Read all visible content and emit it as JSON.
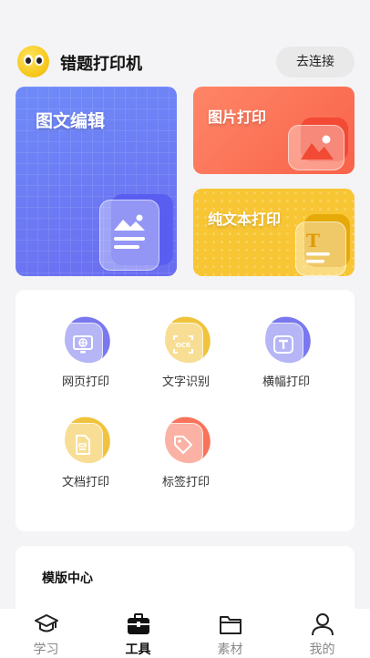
{
  "header": {
    "title": "错题打印机",
    "connect_label": "去连接"
  },
  "features": {
    "edit": {
      "label": "图文编辑",
      "color": "#6c7cf6"
    },
    "image": {
      "label": "图片打印",
      "color": "#f8634a"
    },
    "text": {
      "label": "纯文本打印",
      "color": "#f8c534"
    }
  },
  "tools": [
    {
      "label": "网页打印",
      "icon": "monitor-globe-icon",
      "color": "#7a78ee"
    },
    {
      "label": "文字识别",
      "icon": "ocr-scan-icon",
      "color": "#f0c33c"
    },
    {
      "label": "横幅打印",
      "icon": "banner-text-icon",
      "color": "#7a78ee"
    },
    {
      "label": "文档打印",
      "icon": "document-icon",
      "color": "#f0c33c"
    },
    {
      "label": "标签打印",
      "icon": "tag-icon",
      "color": "#f7735a"
    }
  ],
  "template_section": {
    "title": "模版中心"
  },
  "tabbar": [
    {
      "label": "学习",
      "icon": "graduation-cap-icon",
      "active": false
    },
    {
      "label": "工具",
      "icon": "toolbox-icon",
      "active": true
    },
    {
      "label": "素材",
      "icon": "folder-icon",
      "active": false
    },
    {
      "label": "我的",
      "icon": "user-icon",
      "active": false
    }
  ]
}
